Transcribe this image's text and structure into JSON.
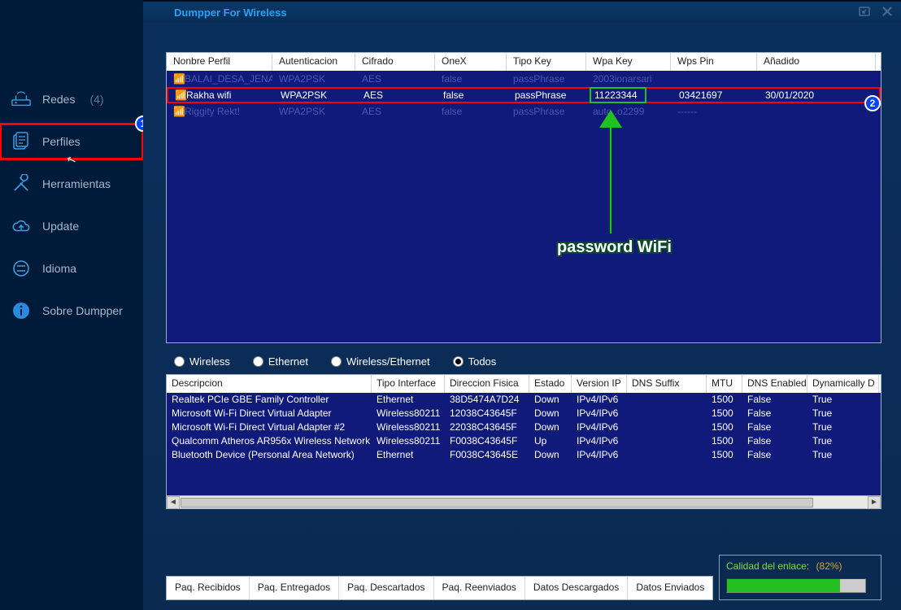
{
  "title": "Dumpper For Wireless",
  "sidebar": {
    "redes": {
      "label": "Redes",
      "count": "(4)"
    },
    "perfiles": {
      "label": "Perfiles"
    },
    "herramientas": {
      "label": "Herramientas"
    },
    "update": {
      "label": "Update"
    },
    "idioma": {
      "label": "Idioma"
    },
    "sobre": {
      "label": "Sobre Dumpper"
    }
  },
  "profiles": {
    "columns": [
      "Nonbre Perfil",
      "Autenticacion",
      "Cifrado",
      "OneX",
      "Tipo Key",
      "Wpa Key",
      "Wps Pin",
      "Añadido"
    ],
    "rows": [
      {
        "name": "BALAI_DESA_JENA...",
        "auth": "WPA2PSK",
        "cipher": "AES",
        "onex": "false",
        "tipo": "passPhrase",
        "wpa": "2003ionarsari",
        "wps": "",
        "added": ""
      },
      {
        "name": "Rakha wifi",
        "auth": "WPA2PSK",
        "cipher": "AES",
        "onex": "false",
        "tipo": "passPhrase",
        "wpa": "11223344",
        "wps": "03421697",
        "added": "30/01/2020"
      },
      {
        "name": "Riggity Rekt!",
        "auth": "WPA2PSK",
        "cipher": "AES",
        "onex": "false",
        "tipo": "passPhrase",
        "wpa": "auto..o2299",
        "wps": "------",
        "added": ""
      }
    ]
  },
  "annotation": {
    "password_label": "password WiFi",
    "badge1": "1",
    "badge2": "2"
  },
  "filters": {
    "wireless": "Wireless",
    "ethernet": "Ethernet",
    "both": "Wireless/Ethernet",
    "todos": "Todos",
    "selected": "todos"
  },
  "adapters": {
    "columns": [
      "Descripcion",
      "Tipo Interface",
      "Direccion Fisica",
      "Estado",
      "Version IP",
      "DNS Suffix",
      "MTU",
      "DNS Enabled",
      "Dynamically D"
    ],
    "rows": [
      {
        "desc": "Realtek PCIe GBE Family Controller",
        "tipo": "Ethernet",
        "mac": "38D5474A7D24",
        "estado": "Down",
        "ver": "IPv4/IPv6",
        "dns": "",
        "mtu": "1500",
        "dnse": "False",
        "dyn": "True"
      },
      {
        "desc": "Microsoft Wi-Fi Direct Virtual Adapter",
        "tipo": "Wireless80211",
        "mac": "12038C43645F",
        "estado": "Down",
        "ver": "IPv4/IPv6",
        "dns": "",
        "mtu": "1500",
        "dnse": "False",
        "dyn": "True"
      },
      {
        "desc": "Microsoft Wi-Fi Direct Virtual Adapter #2",
        "tipo": "Wireless80211",
        "mac": "22038C43645F",
        "estado": "Down",
        "ver": "IPv4/IPv6",
        "dns": "",
        "mtu": "1500",
        "dnse": "False",
        "dyn": "True"
      },
      {
        "desc": "Qualcomm Atheros AR956x Wireless Network ...",
        "tipo": "Wireless80211",
        "mac": "F0038C43645F",
        "estado": "Up",
        "ver": "IPv4/IPv6",
        "dns": "",
        "mtu": "1500",
        "dnse": "False",
        "dyn": "True"
      },
      {
        "desc": "Bluetooth Device (Personal Area Network)",
        "tipo": "Ethernet",
        "mac": "F0038C43645E",
        "estado": "Down",
        "ver": "IPv4/IPv6",
        "dns": "",
        "mtu": "1500",
        "dnse": "False",
        "dyn": "True"
      }
    ]
  },
  "stats": {
    "recibidos": "Paq. Recibidos",
    "entregados": "Paq. Entregados",
    "descartados": "Paq. Descartados",
    "reenviados": "Paq. Reenviados",
    "datos_desc": "Datos Descargados",
    "datos_env": "Datos Enviados"
  },
  "quality": {
    "label": "Calidad del enlace:",
    "pct_text": "(82%)",
    "pct": 82
  }
}
